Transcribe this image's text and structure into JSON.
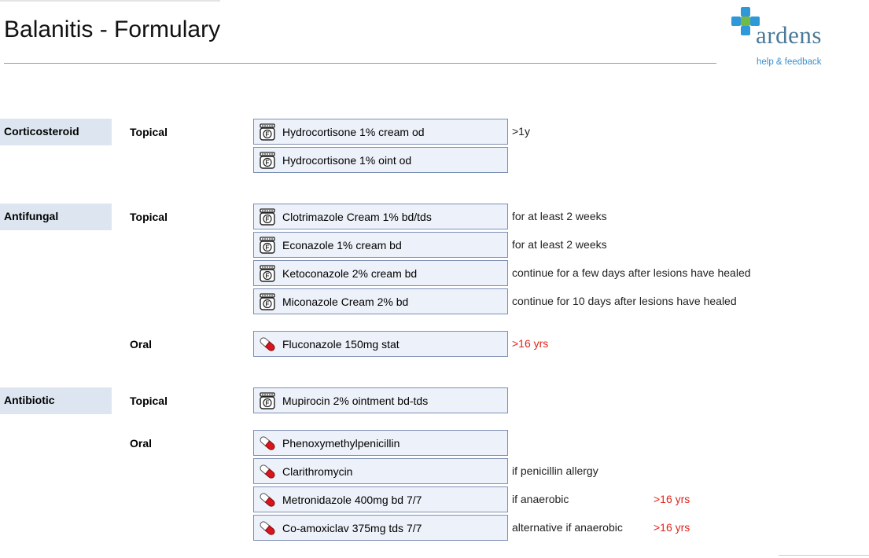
{
  "page": {
    "title": "Balanitis - Formulary"
  },
  "logo": {
    "word": "ardens",
    "link": "help & feedback"
  },
  "colors": {
    "category_bg": "#dde6f0",
    "drug_bg": "#edf1f9",
    "drug_border": "#7e8fb4",
    "warning": "#e0241b",
    "logo": "#4b7a99",
    "link": "#3a8fd0"
  },
  "icons": {
    "cream": "formulary-cream-jar-icon",
    "capsule": "capsule-icon"
  },
  "categories": [
    {
      "name": "Corticosteroid",
      "routes": [
        {
          "route": "Topical",
          "drugs": [
            {
              "name": "Hydrocortisone 1% cream od",
              "icon": "cream",
              "note": ">1y",
              "age": ""
            },
            {
              "name": "Hydrocortisone 1% oint od",
              "icon": "cream",
              "note": "",
              "age": ""
            }
          ]
        }
      ]
    },
    {
      "name": "Antifungal",
      "routes": [
        {
          "route": "Topical",
          "drugs": [
            {
              "name": "Clotrimazole Cream 1% bd/tds",
              "icon": "cream",
              "note": "for at least 2 weeks",
              "age": ""
            },
            {
              "name": "Econazole 1% cream bd",
              "icon": "cream",
              "note": "for at least 2 weeks",
              "age": ""
            },
            {
              "name": "Ketoconazole 2% cream bd",
              "icon": "cream",
              "note": "continue for a few days after lesions have healed",
              "age": ""
            },
            {
              "name": "Miconazole Cream 2% bd",
              "icon": "cream",
              "note": "continue for 10 days after lesions have healed",
              "age": ""
            }
          ]
        },
        {
          "route": "Oral",
          "drugs": [
            {
              "name": "Fluconazole 150mg stat",
              "icon": "capsule",
              "note": ">16 yrs",
              "note_red": true,
              "age": ""
            }
          ]
        }
      ]
    },
    {
      "name": "Antibiotic",
      "routes": [
        {
          "route": "Topical",
          "drugs": [
            {
              "name": "Mupirocin 2% ointment bd-tds",
              "icon": "cream",
              "note": "",
              "age": ""
            }
          ]
        },
        {
          "route": "Oral",
          "drugs": [
            {
              "name": "Phenoxymethylpenicillin",
              "icon": "capsule",
              "note": "",
              "age": ""
            },
            {
              "name": "Clarithromycin",
              "icon": "capsule",
              "note": "if penicillin allergy",
              "age": ""
            },
            {
              "name": "Metronidazole 400mg bd 7/7",
              "icon": "capsule",
              "note": "if anaerobic",
              "age": ">16 yrs"
            },
            {
              "name": "Co-amoxiclav 375mg tds 7/7",
              "icon": "capsule",
              "note": "alternative if anaerobic",
              "age": ">16 yrs"
            }
          ]
        }
      ]
    }
  ]
}
